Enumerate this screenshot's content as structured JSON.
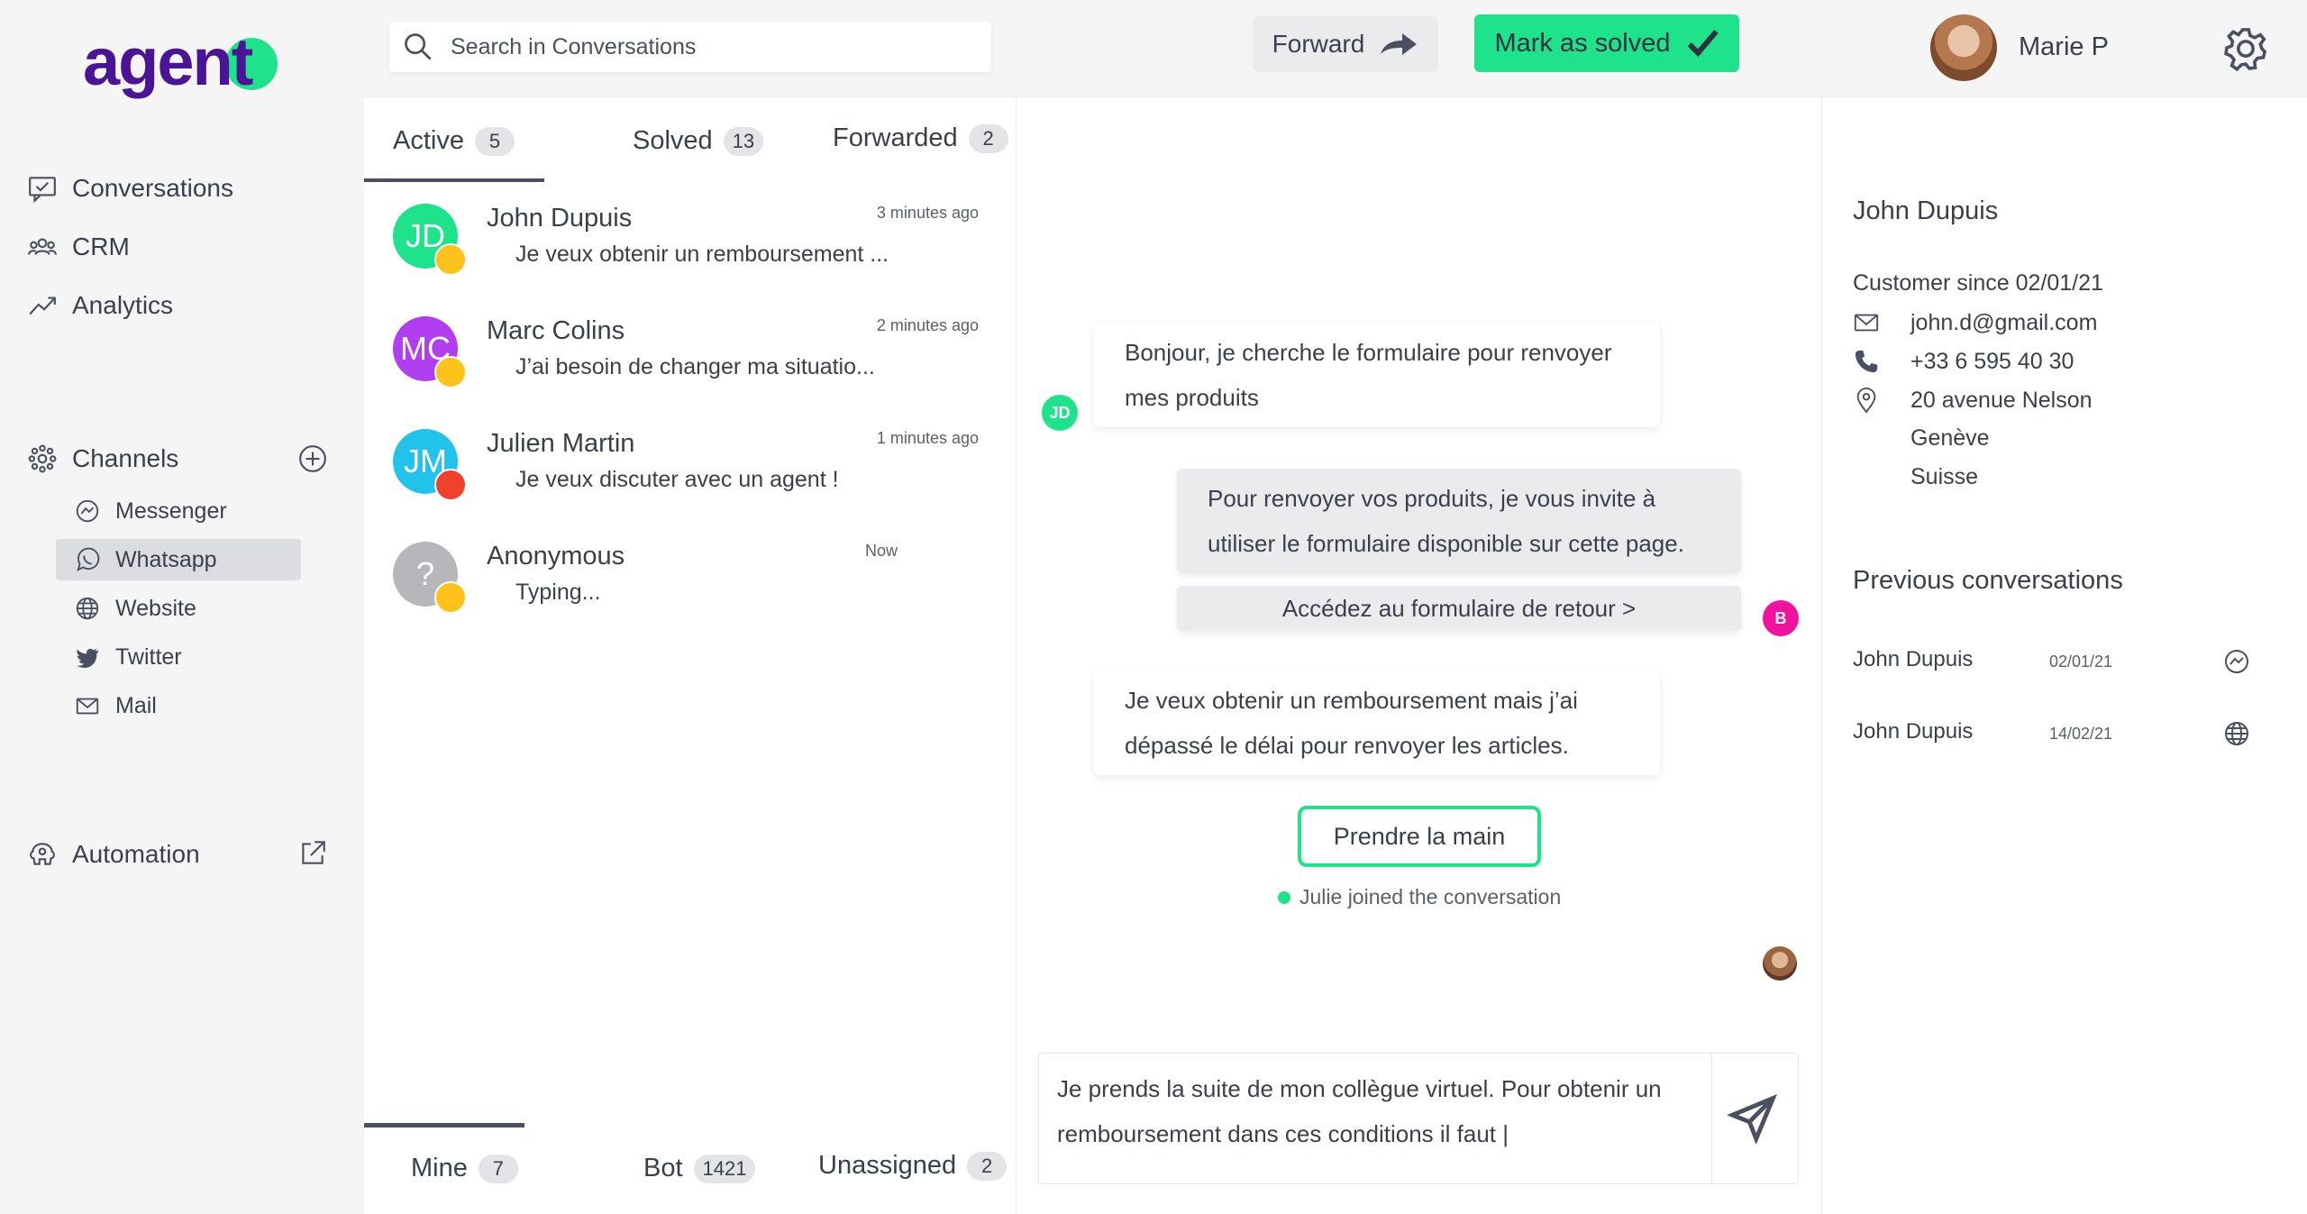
{
  "app": {
    "logo": "agent"
  },
  "colors": {
    "brand": "#4a1494",
    "accent": "#1fe38b"
  },
  "sidebar": {
    "nav": [
      {
        "label": "Conversations",
        "icon": "conversations-icon"
      },
      {
        "label": "CRM",
        "icon": "crm-icon"
      },
      {
        "label": "Analytics",
        "icon": "analytics-icon"
      }
    ],
    "channels_label": "Channels",
    "channels": [
      {
        "label": "Messenger",
        "icon": "messenger-icon"
      },
      {
        "label": "Whatsapp",
        "icon": "whatsapp-icon",
        "active": true
      },
      {
        "label": "Website",
        "icon": "globe-icon"
      },
      {
        "label": "Twitter",
        "icon": "twitter-icon"
      },
      {
        "label": "Mail",
        "icon": "mail-icon"
      }
    ],
    "automation_label": "Automation"
  },
  "topbar": {
    "search_placeholder": "Search in Conversations",
    "forward_label": "Forward",
    "solved_label": "Mark as solved",
    "user_name": "Marie P"
  },
  "list": {
    "tabs": [
      {
        "label": "Active",
        "count": "5"
      },
      {
        "label": "Solved",
        "count": "13"
      },
      {
        "label": "Forwarded",
        "count": "2"
      }
    ],
    "conversations": [
      {
        "initials": "JD",
        "name": "John Dupuis",
        "message": "Je veux obtenir un remboursement ...",
        "time": "3 minutes ago",
        "color": "#1fe38b",
        "mood": "happy"
      },
      {
        "initials": "MC",
        "name": "Marc Colins",
        "message": "J’ai besoin de changer ma situatio...",
        "time": "2 minutes ago",
        "color": "#b03ef0",
        "mood": "neutral"
      },
      {
        "initials": "JM",
        "name": "Julien Martin",
        "message": "Je veux discuter avec un agent !",
        "time": "1 minutes ago",
        "color": "#22c3ea",
        "mood": "angry"
      },
      {
        "initials": "?",
        "name": "Anonymous",
        "message": "Typing...",
        "time": "Now",
        "color": "#b7b7bb",
        "mood": "neutral"
      }
    ],
    "bottom_tabs": [
      {
        "label": "Mine",
        "count": "7"
      },
      {
        "label": "Bot",
        "count": "1421"
      },
      {
        "label": "Unassigned",
        "count": "2"
      }
    ]
  },
  "chat": {
    "messages": [
      {
        "text": "Bonjour, je cherche le formulaire pour renvoyer mes produits",
        "from": "customer",
        "avatar": "JD"
      },
      {
        "text": "Pour renvoyer vos produits, je vous invite à utiliser le formulaire disponible sur cette page.",
        "from": "bot",
        "avatar": "B"
      },
      {
        "text": "Accédez au formulaire de retour >",
        "from": "bot-link"
      },
      {
        "text": "Je veux obtenir un remboursement mais j’ai dépassé le délai pour renvoyer les articles.",
        "from": "customer"
      }
    ],
    "take_over_label": "Prendre la main",
    "joined_text": "Julie joined the conversation",
    "composer_text": "Je prends la suite de mon collègue virtuel. Pour obtenir un remboursement dans ces conditions il faut |"
  },
  "info": {
    "name": "John Dupuis",
    "customer_since": "Customer since 02/01/21",
    "email": "john.d@gmail.com",
    "phone": "+33 6 595 40 30",
    "address_line1": "20 avenue Nelson",
    "address_line2": "Genève",
    "address_line3": "Suisse",
    "previous_title": "Previous conversations",
    "previous": [
      {
        "name": "John Dupuis",
        "date": "02/01/21",
        "icon": "messenger-icon"
      },
      {
        "name": "John Dupuis",
        "date": "14/02/21",
        "icon": "globe-icon"
      }
    ]
  }
}
